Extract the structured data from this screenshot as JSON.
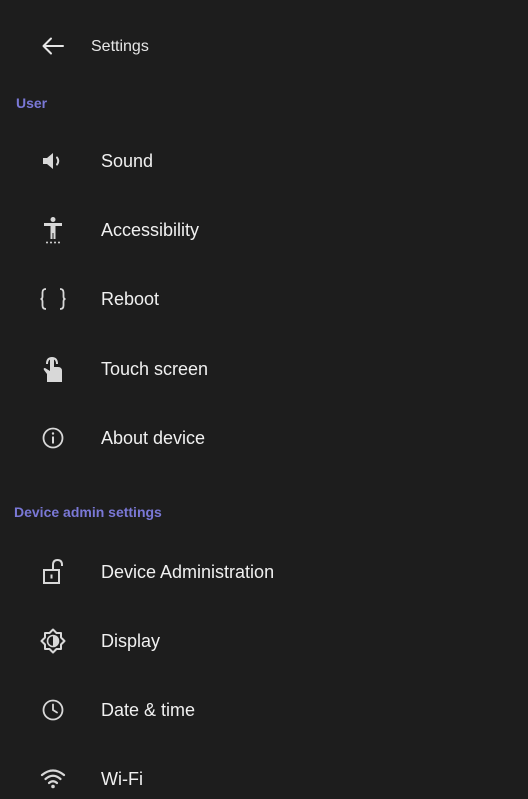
{
  "header": {
    "back_icon": "arrow-left-icon",
    "title": "Settings"
  },
  "sections": [
    {
      "title": "User",
      "items": [
        {
          "label": "Sound",
          "icon": "volume-icon"
        },
        {
          "label": "Accessibility",
          "icon": "accessibility-icon"
        },
        {
          "label": "Reboot",
          "icon": "braces-icon"
        },
        {
          "label": "Touch screen",
          "icon": "touch-icon"
        },
        {
          "label": "About device",
          "icon": "info-icon"
        }
      ]
    },
    {
      "title": "Device admin settings",
      "items": [
        {
          "label": "Device Administration",
          "icon": "unlock-icon"
        },
        {
          "label": "Display",
          "icon": "brightness-icon"
        },
        {
          "label": "Date & time",
          "icon": "clock-icon"
        },
        {
          "label": "Wi-Fi",
          "icon": "wifi-icon"
        }
      ]
    }
  ],
  "colors": {
    "background": "#1d1d1d",
    "section_title": "#7a78d6",
    "text": "#f0f0f0",
    "icon": "#d8d8d8"
  }
}
